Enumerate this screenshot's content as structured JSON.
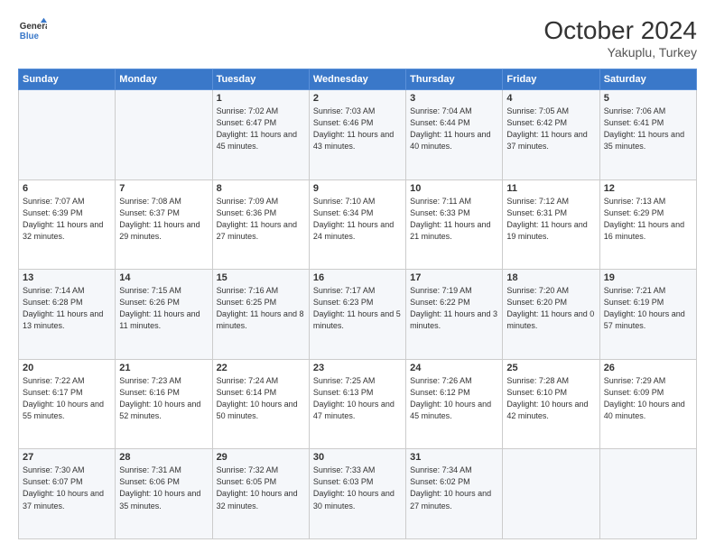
{
  "header": {
    "logo_line1": "General",
    "logo_line2": "Blue",
    "month": "October 2024",
    "location": "Yakuplu, Turkey"
  },
  "weekdays": [
    "Sunday",
    "Monday",
    "Tuesday",
    "Wednesday",
    "Thursday",
    "Friday",
    "Saturday"
  ],
  "weeks": [
    [
      {
        "day": "",
        "sunrise": "",
        "sunset": "",
        "daylight": ""
      },
      {
        "day": "",
        "sunrise": "",
        "sunset": "",
        "daylight": ""
      },
      {
        "day": "1",
        "sunrise": "Sunrise: 7:02 AM",
        "sunset": "Sunset: 6:47 PM",
        "daylight": "Daylight: 11 hours and 45 minutes."
      },
      {
        "day": "2",
        "sunrise": "Sunrise: 7:03 AM",
        "sunset": "Sunset: 6:46 PM",
        "daylight": "Daylight: 11 hours and 43 minutes."
      },
      {
        "day": "3",
        "sunrise": "Sunrise: 7:04 AM",
        "sunset": "Sunset: 6:44 PM",
        "daylight": "Daylight: 11 hours and 40 minutes."
      },
      {
        "day": "4",
        "sunrise": "Sunrise: 7:05 AM",
        "sunset": "Sunset: 6:42 PM",
        "daylight": "Daylight: 11 hours and 37 minutes."
      },
      {
        "day": "5",
        "sunrise": "Sunrise: 7:06 AM",
        "sunset": "Sunset: 6:41 PM",
        "daylight": "Daylight: 11 hours and 35 minutes."
      }
    ],
    [
      {
        "day": "6",
        "sunrise": "Sunrise: 7:07 AM",
        "sunset": "Sunset: 6:39 PM",
        "daylight": "Daylight: 11 hours and 32 minutes."
      },
      {
        "day": "7",
        "sunrise": "Sunrise: 7:08 AM",
        "sunset": "Sunset: 6:37 PM",
        "daylight": "Daylight: 11 hours and 29 minutes."
      },
      {
        "day": "8",
        "sunrise": "Sunrise: 7:09 AM",
        "sunset": "Sunset: 6:36 PM",
        "daylight": "Daylight: 11 hours and 27 minutes."
      },
      {
        "day": "9",
        "sunrise": "Sunrise: 7:10 AM",
        "sunset": "Sunset: 6:34 PM",
        "daylight": "Daylight: 11 hours and 24 minutes."
      },
      {
        "day": "10",
        "sunrise": "Sunrise: 7:11 AM",
        "sunset": "Sunset: 6:33 PM",
        "daylight": "Daylight: 11 hours and 21 minutes."
      },
      {
        "day": "11",
        "sunrise": "Sunrise: 7:12 AM",
        "sunset": "Sunset: 6:31 PM",
        "daylight": "Daylight: 11 hours and 19 minutes."
      },
      {
        "day": "12",
        "sunrise": "Sunrise: 7:13 AM",
        "sunset": "Sunset: 6:29 PM",
        "daylight": "Daylight: 11 hours and 16 minutes."
      }
    ],
    [
      {
        "day": "13",
        "sunrise": "Sunrise: 7:14 AM",
        "sunset": "Sunset: 6:28 PM",
        "daylight": "Daylight: 11 hours and 13 minutes."
      },
      {
        "day": "14",
        "sunrise": "Sunrise: 7:15 AM",
        "sunset": "Sunset: 6:26 PM",
        "daylight": "Daylight: 11 hours and 11 minutes."
      },
      {
        "day": "15",
        "sunrise": "Sunrise: 7:16 AM",
        "sunset": "Sunset: 6:25 PM",
        "daylight": "Daylight: 11 hours and 8 minutes."
      },
      {
        "day": "16",
        "sunrise": "Sunrise: 7:17 AM",
        "sunset": "Sunset: 6:23 PM",
        "daylight": "Daylight: 11 hours and 5 minutes."
      },
      {
        "day": "17",
        "sunrise": "Sunrise: 7:19 AM",
        "sunset": "Sunset: 6:22 PM",
        "daylight": "Daylight: 11 hours and 3 minutes."
      },
      {
        "day": "18",
        "sunrise": "Sunrise: 7:20 AM",
        "sunset": "Sunset: 6:20 PM",
        "daylight": "Daylight: 11 hours and 0 minutes."
      },
      {
        "day": "19",
        "sunrise": "Sunrise: 7:21 AM",
        "sunset": "Sunset: 6:19 PM",
        "daylight": "Daylight: 10 hours and 57 minutes."
      }
    ],
    [
      {
        "day": "20",
        "sunrise": "Sunrise: 7:22 AM",
        "sunset": "Sunset: 6:17 PM",
        "daylight": "Daylight: 10 hours and 55 minutes."
      },
      {
        "day": "21",
        "sunrise": "Sunrise: 7:23 AM",
        "sunset": "Sunset: 6:16 PM",
        "daylight": "Daylight: 10 hours and 52 minutes."
      },
      {
        "day": "22",
        "sunrise": "Sunrise: 7:24 AM",
        "sunset": "Sunset: 6:14 PM",
        "daylight": "Daylight: 10 hours and 50 minutes."
      },
      {
        "day": "23",
        "sunrise": "Sunrise: 7:25 AM",
        "sunset": "Sunset: 6:13 PM",
        "daylight": "Daylight: 10 hours and 47 minutes."
      },
      {
        "day": "24",
        "sunrise": "Sunrise: 7:26 AM",
        "sunset": "Sunset: 6:12 PM",
        "daylight": "Daylight: 10 hours and 45 minutes."
      },
      {
        "day": "25",
        "sunrise": "Sunrise: 7:28 AM",
        "sunset": "Sunset: 6:10 PM",
        "daylight": "Daylight: 10 hours and 42 minutes."
      },
      {
        "day": "26",
        "sunrise": "Sunrise: 7:29 AM",
        "sunset": "Sunset: 6:09 PM",
        "daylight": "Daylight: 10 hours and 40 minutes."
      }
    ],
    [
      {
        "day": "27",
        "sunrise": "Sunrise: 7:30 AM",
        "sunset": "Sunset: 6:07 PM",
        "daylight": "Daylight: 10 hours and 37 minutes."
      },
      {
        "day": "28",
        "sunrise": "Sunrise: 7:31 AM",
        "sunset": "Sunset: 6:06 PM",
        "daylight": "Daylight: 10 hours and 35 minutes."
      },
      {
        "day": "29",
        "sunrise": "Sunrise: 7:32 AM",
        "sunset": "Sunset: 6:05 PM",
        "daylight": "Daylight: 10 hours and 32 minutes."
      },
      {
        "day": "30",
        "sunrise": "Sunrise: 7:33 AM",
        "sunset": "Sunset: 6:03 PM",
        "daylight": "Daylight: 10 hours and 30 minutes."
      },
      {
        "day": "31",
        "sunrise": "Sunrise: 7:34 AM",
        "sunset": "Sunset: 6:02 PM",
        "daylight": "Daylight: 10 hours and 27 minutes."
      },
      {
        "day": "",
        "sunrise": "",
        "sunset": "",
        "daylight": ""
      },
      {
        "day": "",
        "sunrise": "",
        "sunset": "",
        "daylight": ""
      }
    ]
  ]
}
